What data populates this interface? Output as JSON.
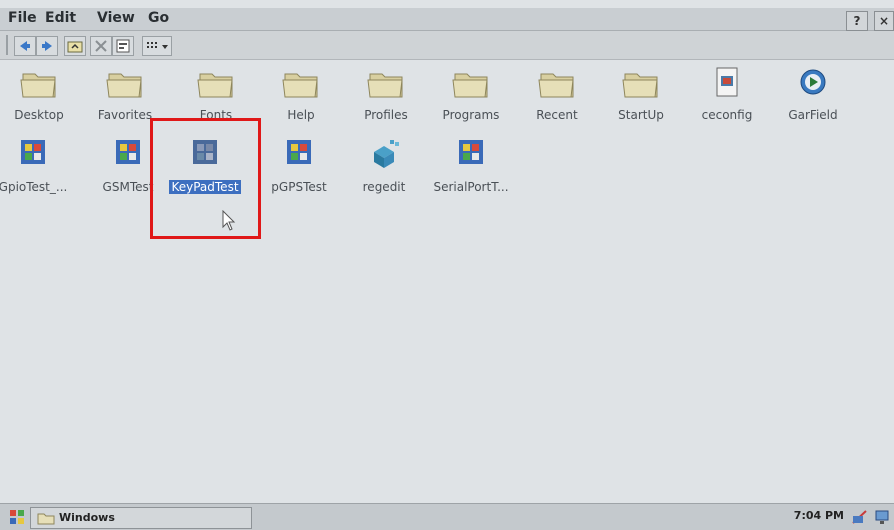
{
  "menu": {
    "items": [
      {
        "label": "File"
      },
      {
        "label": "Edit"
      },
      {
        "label": "View"
      },
      {
        "label": "Go"
      }
    ],
    "help_label": "?"
  },
  "toolbar": {
    "buttons": [
      "back-icon",
      "forward-icon",
      "up-folder-icon",
      "delete-icon",
      "properties-icon",
      "views-icon"
    ]
  },
  "icons_row1": [
    {
      "label": "Desktop",
      "icon": "folder-icon"
    },
    {
      "label": "Favorites",
      "icon": "folder-icon"
    },
    {
      "label": "Fonts",
      "icon": "folder-icon"
    },
    {
      "label": "Help",
      "icon": "folder-icon"
    },
    {
      "label": "Profiles",
      "icon": "folder-icon"
    },
    {
      "label": "Programs",
      "icon": "folder-icon"
    },
    {
      "label": "Recent",
      "icon": "folder-icon"
    },
    {
      "label": "StartUp",
      "icon": "folder-icon"
    },
    {
      "label": "ceconfig",
      "icon": "ceconfig-icon"
    },
    {
      "label": "GarField",
      "icon": "media-icon"
    }
  ],
  "icons_row2": [
    {
      "label": "GpioTest_...",
      "icon": "app-icon"
    },
    {
      "label": "GSMTest",
      "icon": "app-icon"
    },
    {
      "label": "KeyPadTest",
      "icon": "app-icon",
      "selected": true
    },
    {
      "label": "pGPSTest",
      "icon": "app-icon"
    },
    {
      "label": "regedit",
      "icon": "registry-icon"
    },
    {
      "label": "SerialPortT...",
      "icon": "app-icon"
    }
  ],
  "taskbar": {
    "window_label": "Windows",
    "clock": "7:04 PM"
  },
  "colors": {
    "desktop_bg": "#dfe3e6",
    "selection": "#3d6fc0",
    "highlight_box": "#e01818"
  }
}
